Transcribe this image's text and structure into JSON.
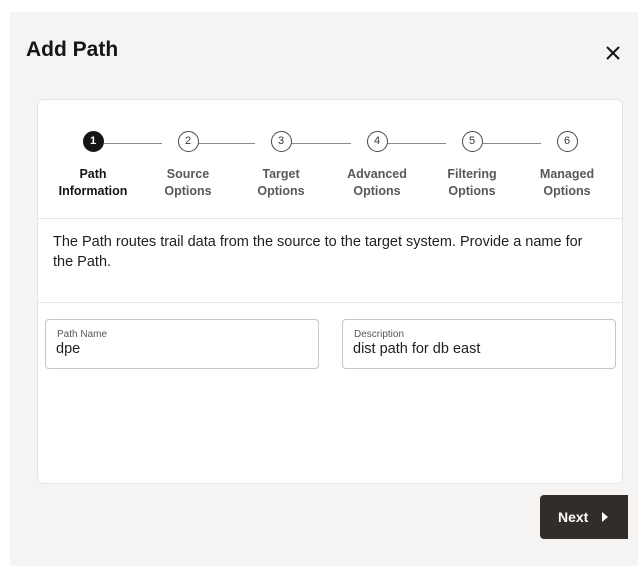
{
  "dialog": {
    "title": "Add Path",
    "close_icon": "close-icon"
  },
  "stepper": {
    "steps": [
      {
        "number": "1",
        "line1": "Path",
        "line2": "Information",
        "active": true
      },
      {
        "number": "2",
        "line1": "Source",
        "line2": "Options",
        "active": false
      },
      {
        "number": "3",
        "line1": "Target",
        "line2": "Options",
        "active": false
      },
      {
        "number": "4",
        "line1": "Advanced",
        "line2": "Options",
        "active": false
      },
      {
        "number": "5",
        "line1": "Filtering",
        "line2": "Options",
        "active": false
      },
      {
        "number": "6",
        "line1": "Managed",
        "line2": "Options",
        "active": false
      }
    ]
  },
  "intro_text": "The Path routes trail data from the source to the target system. Provide a name for the Path.",
  "fields": {
    "path_name": {
      "label": "Path Name",
      "value": "dpe"
    },
    "description": {
      "label": "Description",
      "value": "dist path for db east"
    }
  },
  "footer": {
    "next_label": "Next",
    "next_icon": "chevron-right-icon"
  },
  "colors": {
    "dialog_bg": "#f5f4f2",
    "card_bg": "#ffffff",
    "active_step": "#161513",
    "next_button_bg": "#312d2a"
  }
}
